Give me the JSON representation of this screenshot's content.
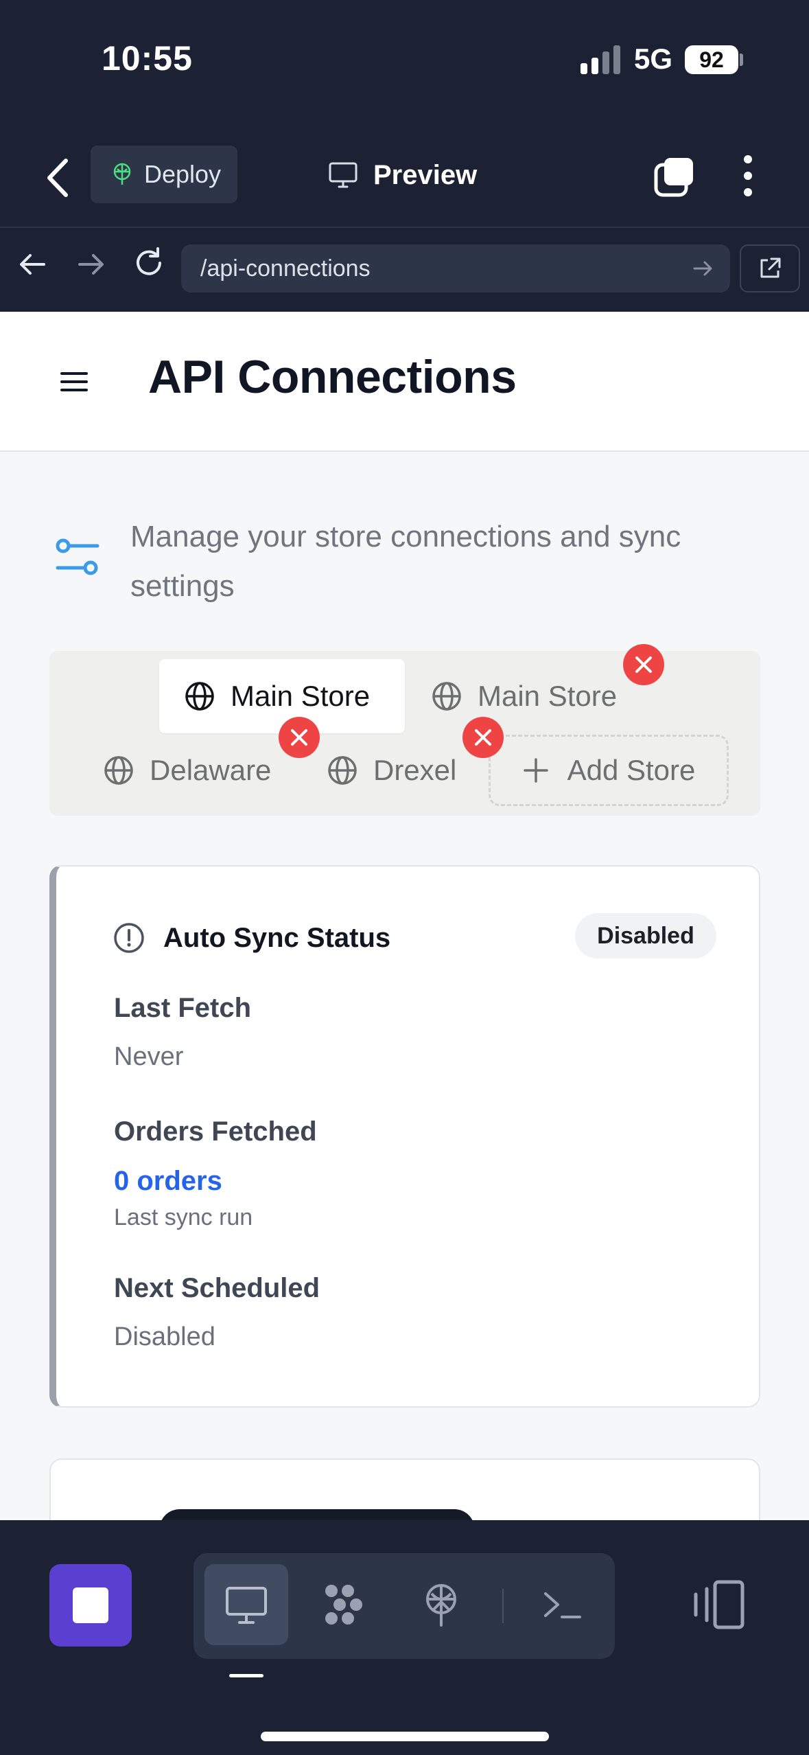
{
  "status_bar": {
    "time": "10:55",
    "network": "5G",
    "battery": "92"
  },
  "toolbar": {
    "deploy_label": "Deploy",
    "preview_label": "Preview"
  },
  "browser": {
    "url": "/api-connections"
  },
  "page": {
    "title": "API Connections",
    "subtitle": "Manage your store connections and sync settings"
  },
  "store_tabs": {
    "tabs": [
      {
        "label": "Main Store",
        "active": true,
        "icon": "globe-icon"
      },
      {
        "label": "Main Store",
        "active": false,
        "icon": "globe-icon"
      },
      {
        "label": "Delaware",
        "active": false,
        "icon": "globe-icon"
      },
      {
        "label": "Drexel",
        "active": false,
        "icon": "globe-icon"
      }
    ],
    "add_label": "Add Store"
  },
  "auto_sync": {
    "title": "Auto Sync Status",
    "status": "Disabled",
    "last_fetch_label": "Last Fetch",
    "last_fetch_value": "Never",
    "orders_label": "Orders Fetched",
    "orders_value": "0 orders",
    "orders_caption": "Last sync run",
    "next_label": "Next Scheduled",
    "next_value": "Disabled"
  },
  "colors": {
    "chrome_bg": "#1c2233",
    "accent_purple": "#5b3fd1",
    "link_blue": "#2563eb",
    "danger_red": "#ef4444",
    "icon_blue": "#3b9be8"
  },
  "dock": {
    "items": [
      "monitor-icon",
      "workflow-icon",
      "deploy-icon",
      "terminal-icon"
    ],
    "active": "monitor-icon"
  }
}
